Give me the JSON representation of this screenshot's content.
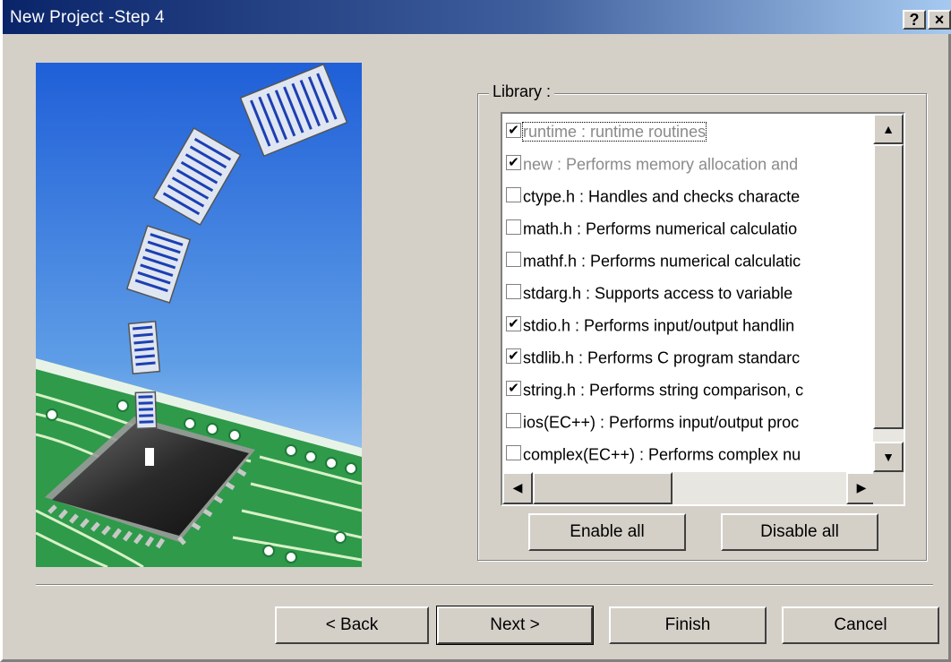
{
  "window": {
    "title": "New Project -Step 4",
    "help_button": "?",
    "close_button": "×"
  },
  "library": {
    "label": "Library :",
    "items": [
      {
        "checked": true,
        "enabled": false,
        "text": "runtime : runtime routines"
      },
      {
        "checked": true,
        "enabled": false,
        "text": "new : Performs memory allocation and"
      },
      {
        "checked": false,
        "enabled": true,
        "text": "ctype.h : Handles and checks characte"
      },
      {
        "checked": false,
        "enabled": true,
        "text": "math.h : Performs numerical calculatio"
      },
      {
        "checked": false,
        "enabled": true,
        "text": "mathf.h : Performs numerical calculatic"
      },
      {
        "checked": false,
        "enabled": true,
        "text": "stdarg.h : Supports access to variable"
      },
      {
        "checked": true,
        "enabled": true,
        "text": "stdio.h : Performs input/output handlin"
      },
      {
        "checked": true,
        "enabled": true,
        "text": "stdlib.h : Performs C program standarc"
      },
      {
        "checked": true,
        "enabled": true,
        "text": "string.h : Performs string comparison, c"
      },
      {
        "checked": false,
        "enabled": true,
        "text": "ios(EC++) : Performs input/output proc"
      },
      {
        "checked": false,
        "enabled": true,
        "text": "complex(EC++) : Performs complex nu"
      }
    ],
    "enable_all": "Enable all",
    "disable_all": "Disable all"
  },
  "footer": {
    "back": "< Back",
    "next": "Next >",
    "finish": "Finish",
    "cancel": "Cancel"
  },
  "colors": {
    "titlebar_start": "#0a246a",
    "titlebar_end": "#a6caf0",
    "face": "#d4d0c8"
  }
}
